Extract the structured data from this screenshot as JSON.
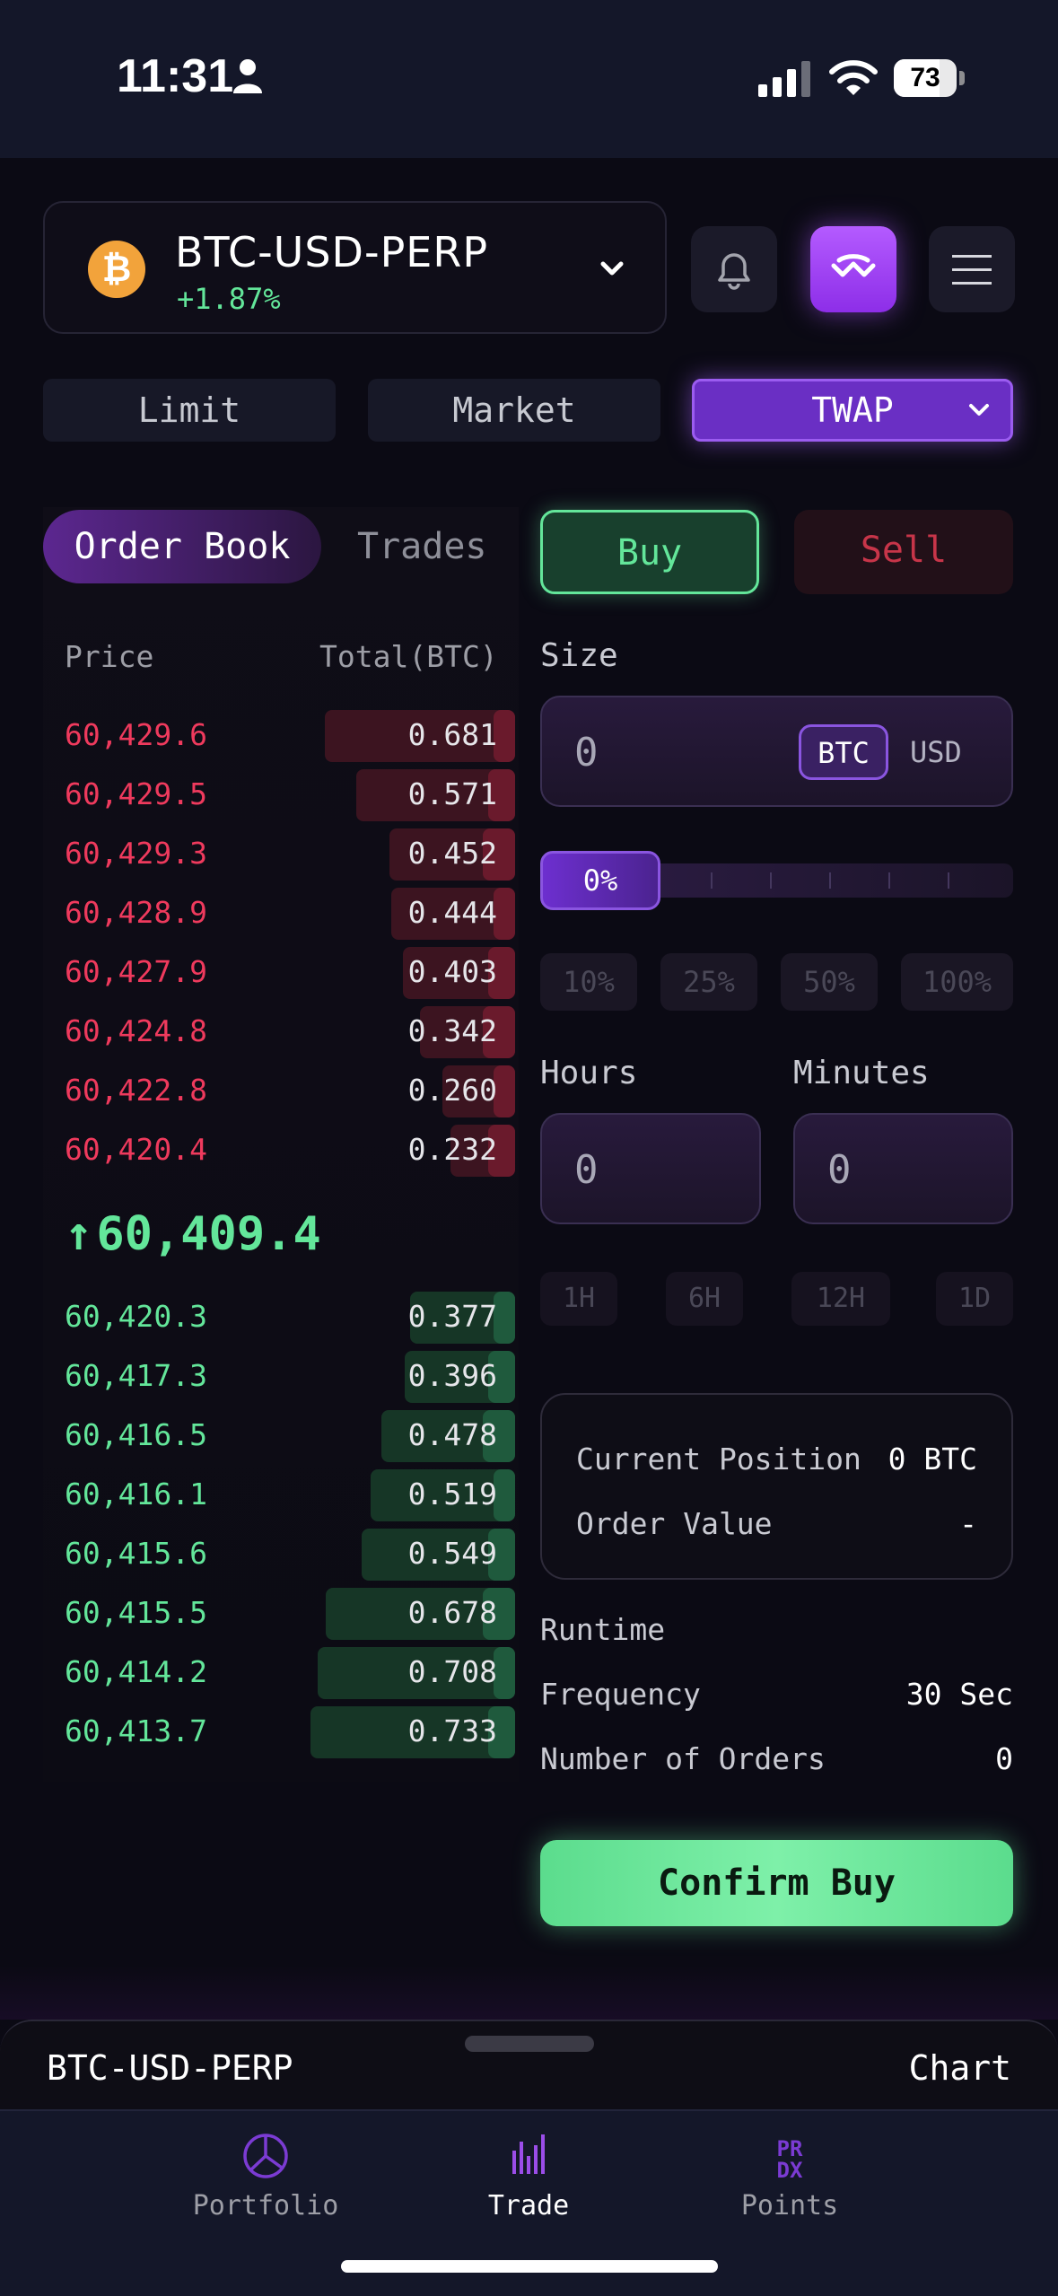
{
  "status_bar": {
    "time": "11:31",
    "battery": "73",
    "battery_level": 0.73
  },
  "market": {
    "symbol": "BTC-USD-PERP",
    "change": "+1.87%",
    "coin_glyph": "₿",
    "coin_color": "#f2a33b"
  },
  "order_types": {
    "limit": "Limit",
    "market": "Market",
    "twap": "TWAP"
  },
  "book_tabs": {
    "order_book": "Order Book",
    "trades": "Trades"
  },
  "book_headers": {
    "price": "Price",
    "total": "Total(BTC)"
  },
  "asks": [
    {
      "price": "60,429.6",
      "total": "0.681",
      "depth": 0.681
    },
    {
      "price": "60,429.5",
      "total": "0.571",
      "depth": 0.571
    },
    {
      "price": "60,429.3",
      "total": "0.452",
      "depth": 0.452
    },
    {
      "price": "60,428.9",
      "total": "0.444",
      "depth": 0.444
    },
    {
      "price": "60,427.9",
      "total": "0.403",
      "depth": 0.403
    },
    {
      "price": "60,424.8",
      "total": "0.342",
      "depth": 0.342
    },
    {
      "price": "60,422.8",
      "total": "0.260",
      "depth": 0.26
    },
    {
      "price": "60,420.4",
      "total": "0.232",
      "depth": 0.232
    }
  ],
  "mid_price": {
    "arrow": "↑",
    "value": "60,409.4"
  },
  "bids": [
    {
      "price": "60,420.3",
      "total": "0.377",
      "depth": 0.377
    },
    {
      "price": "60,417.3",
      "total": "0.396",
      "depth": 0.396
    },
    {
      "price": "60,416.5",
      "total": "0.478",
      "depth": 0.478
    },
    {
      "price": "60,416.1",
      "total": "0.519",
      "depth": 0.519
    },
    {
      "price": "60,415.6",
      "total": "0.549",
      "depth": 0.549
    },
    {
      "price": "60,415.5",
      "total": "0.678",
      "depth": 0.678
    },
    {
      "price": "60,414.2",
      "total": "0.708",
      "depth": 0.708
    },
    {
      "price": "60,413.7",
      "total": "0.733",
      "depth": 0.733
    }
  ],
  "side": {
    "buy": "Buy",
    "sell": "Sell"
  },
  "size": {
    "label": "Size",
    "value": "0",
    "unit_btc": "BTC",
    "unit_usd": "USD"
  },
  "slider": {
    "value": "0%",
    "presets": [
      "10%",
      "25%",
      "50%",
      "100%"
    ]
  },
  "duration": {
    "hours_label": "Hours",
    "hours_value": "0",
    "minutes_label": "Minutes",
    "minutes_value": "0",
    "quick": [
      "1H",
      "6H",
      "12H",
      "1D"
    ]
  },
  "summary": {
    "current_position_label": "Current Position",
    "current_position_value": "0 BTC",
    "order_value_label": "Order Value",
    "order_value_value": "-"
  },
  "twap_info": {
    "runtime_label": "Runtime",
    "frequency_label": "Frequency",
    "frequency_value": "30 Sec",
    "orders_label": "Number of Orders",
    "orders_value": "0"
  },
  "confirm_label": "Confirm Buy",
  "sheet": {
    "left": "BTC-USD-PERP",
    "right": "Chart"
  },
  "nav": [
    {
      "label": "Portfolio",
      "icon": "pie-chart-icon"
    },
    {
      "label": "Trade",
      "icon": "bars-icon"
    },
    {
      "label": "Points",
      "icon": "points-logo-icon"
    }
  ],
  "colors": {
    "ask": "#ef3a5d",
    "bid": "#63e69a",
    "accent": "#8a55e0"
  }
}
